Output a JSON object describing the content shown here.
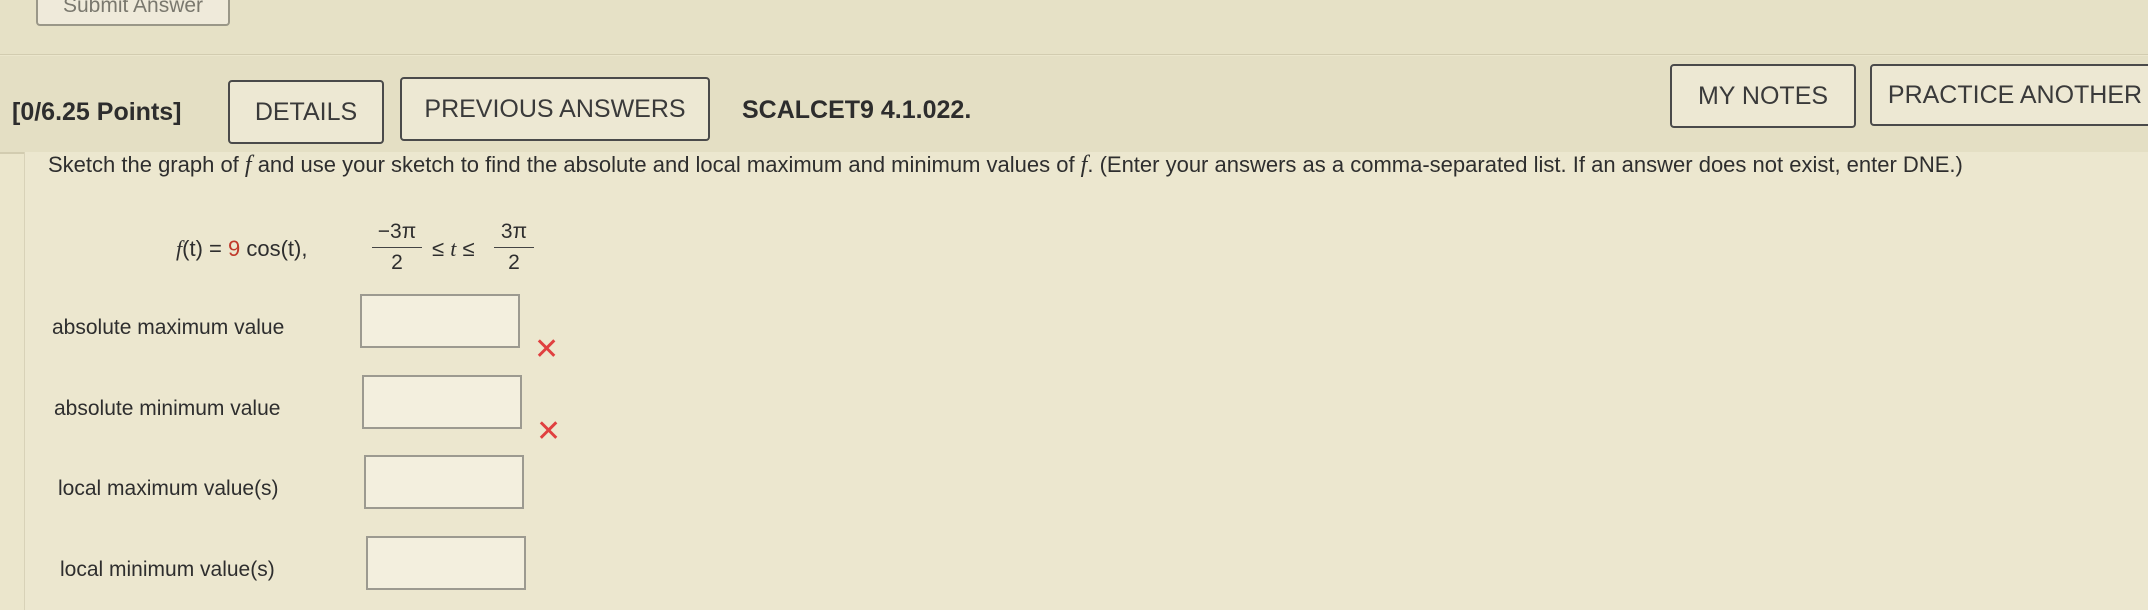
{
  "top": {
    "submit_label": "Submit Answer"
  },
  "header": {
    "points": "[0/6.25 Points]",
    "details_label": "DETAILS",
    "previous_answers_label": "PREVIOUS ANSWERS",
    "source": "SCALCET9 4.1.022.",
    "my_notes_label": "MY NOTES",
    "practice_another_label": "PRACTICE ANOTHER"
  },
  "question": {
    "part1": "Sketch the graph of ",
    "var1": "f",
    "part2": " and use your sketch to find the absolute and local maximum and minimum values of ",
    "var2": "f",
    "part3": ". (Enter your answers as a comma-separated list. If an answer does not exist, enter DNE.)"
  },
  "formula": {
    "fname": "f",
    "open": "(t) = ",
    "coef": "9",
    "body": " cos(t),",
    "left_num": "−3π",
    "left_den": "2",
    "ineq_leq1": "≤",
    "ineq_var": "t",
    "ineq_leq2": "≤",
    "right_num": "3π",
    "right_den": "2"
  },
  "answers": [
    {
      "label": "absolute maximum value",
      "value": "",
      "status": "incorrect"
    },
    {
      "label": "absolute minimum value",
      "value": "",
      "status": "incorrect"
    },
    {
      "label": "local maximum value(s)",
      "value": "",
      "status": ""
    },
    {
      "label": "local minimum value(s)",
      "value": "",
      "status": ""
    }
  ],
  "icons": {
    "incorrect": "x-mark-icon"
  },
  "colors": {
    "incorrect": "#e04040",
    "coefficient": "#c0392b"
  }
}
